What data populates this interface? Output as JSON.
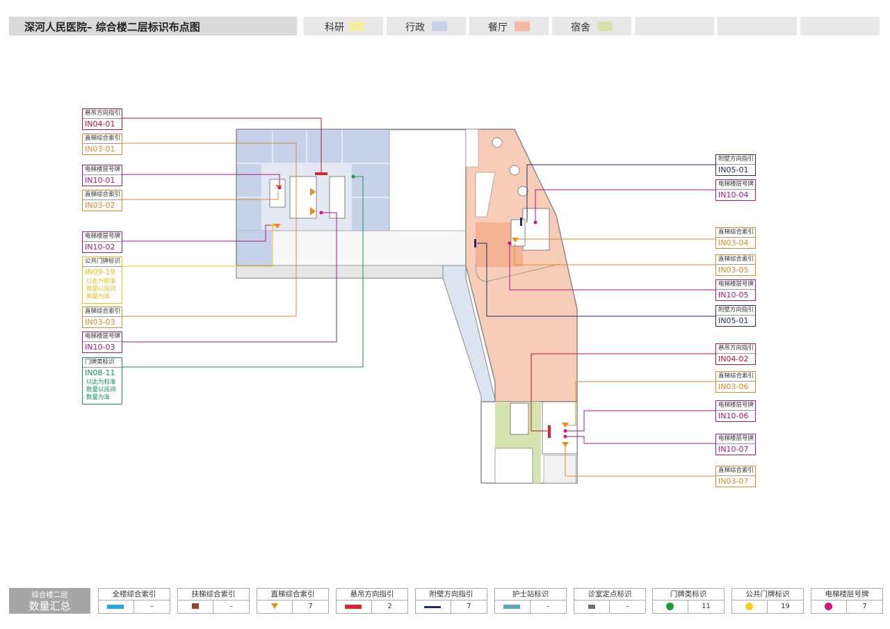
{
  "title": "深河人民医院– 综合楼二层标识布点图",
  "legend": [
    {
      "label": "科研",
      "color": "#f5eea1"
    },
    {
      "label": "行政",
      "color": "#c5d2ea"
    },
    {
      "label": "餐厅",
      "color": "#f4b9a0"
    },
    {
      "label": "宿舍",
      "color": "#d6e4b0"
    }
  ],
  "callouts_left": [
    {
      "title": "悬吊方向指引",
      "code": "IN04-01",
      "color": "#c8102e"
    },
    {
      "title": "直梯综合索引",
      "code": "IN03-01",
      "color": "#e08a26"
    },
    {
      "title": "电梯楼层号牌",
      "code": "IN10-01",
      "color": "#a8168b"
    },
    {
      "title": "直梯综合索引",
      "code": "IN03-02",
      "color": "#e08a26"
    },
    {
      "title": "电梯楼层号牌",
      "code": "IN10-02",
      "color": "#a8168b"
    },
    {
      "title": "公共门牌标识",
      "code": "IN09-19",
      "color": "#e8c215",
      "note": [
        "以此为标准",
        "数量以房间",
        "数量为准"
      ]
    },
    {
      "title": "直梯综合索引",
      "code": "IN03-03",
      "color": "#e08a26"
    },
    {
      "title": "电梯楼层号牌",
      "code": "IN10-03",
      "color": "#a8168b"
    },
    {
      "title": "门牌类标识",
      "code": "IN08-11",
      "color": "#15905a",
      "note": [
        "以此为标准",
        "数量以房间",
        "数量为准"
      ]
    }
  ],
  "callouts_right": [
    {
      "title": "附壁方向指引",
      "code": "IN05-01",
      "color": "#1d2a6e"
    },
    {
      "title": "电梯楼层号牌",
      "code": "IN10-04",
      "color": "#a8168b"
    },
    {
      "title": "直梯综合索引",
      "code": "IN03-04",
      "color": "#e08a26"
    },
    {
      "title": "直梯综合索引",
      "code": "IN03-05",
      "color": "#e08a26"
    },
    {
      "title": "电梯楼层号牌",
      "code": "IN10-05",
      "color": "#a8168b"
    },
    {
      "title": "附壁方向指引",
      "code": "IN05-01",
      "color": "#1d2a6e"
    },
    {
      "title": "悬吊方向指引",
      "code": "IN04-02",
      "color": "#c8102e"
    },
    {
      "title": "直梯综合索引",
      "code": "IN03-06",
      "color": "#e08a26"
    },
    {
      "title": "电梯楼层号牌",
      "code": "IN10-06",
      "color": "#a8168b"
    },
    {
      "title": "电梯楼层号牌",
      "code": "IN10-07",
      "color": "#a8168b"
    },
    {
      "title": "直梯综合索引",
      "code": "IN03-07",
      "color": "#e08a26"
    }
  ],
  "summary": {
    "head_line1": "综合楼二层",
    "head_line2": "数量汇总",
    "items": [
      {
        "label": "全楼综合索引",
        "value": "–",
        "icon": "bar",
        "color": "#29a8e0"
      },
      {
        "label": "扶梯综合索引",
        "value": "–",
        "icon": "escalator",
        "color": "#8b4a2b"
      },
      {
        "label": "直梯综合索引",
        "value": "7",
        "icon": "elevator",
        "color": "#f08c1e"
      },
      {
        "label": "悬吊方向指引",
        "value": "2",
        "icon": "bar",
        "color": "#d7262e"
      },
      {
        "label": "附壁方向指引",
        "value": "7",
        "icon": "wall",
        "color": "#1d2a6e"
      },
      {
        "label": "护士站标识",
        "value": "–",
        "icon": "bar",
        "color": "#5aa8b0"
      },
      {
        "label": "诊室定点标识",
        "value": "–",
        "icon": "small",
        "color": "#7a6a68"
      },
      {
        "label": "门牌类标识",
        "value": "11",
        "icon": "dot",
        "color": "#1f9a3a"
      },
      {
        "label": "公共门牌标识",
        "value": "19",
        "icon": "dot",
        "color": "#f2d21b"
      },
      {
        "label": "电梯楼层号牌",
        "value": "7",
        "icon": "dot",
        "color": "#d8137d"
      }
    ]
  }
}
